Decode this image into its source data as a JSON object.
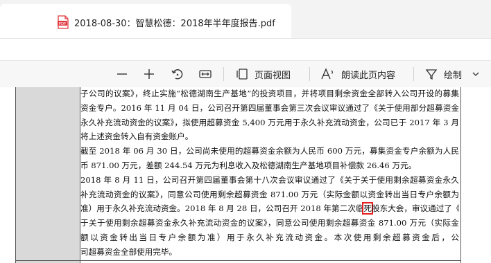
{
  "tab": {
    "title": "2018-08-30：智慧松德：2018年半年度报告.pdf",
    "icon": "pdf-file-icon",
    "icon_text": "PDF",
    "icon_color": "#e0383e"
  },
  "toolbar": {
    "zoom_out": "minus-icon",
    "zoom_in": "plus-icon",
    "rotate": "rotate-icon",
    "fit": "fit-width-icon",
    "page_view_label": "页面视图",
    "read_aloud_label": "朗读此页内容",
    "draw_label": "绘制"
  },
  "document": {
    "lines": [
      "子公司的议案》，终止实施“松德湖南生产基地”的投资项目，并将项目剩余资金全部转入公司开设的募集",
      "资金专户。2016 年 11 月 04 日，公司召开第四届董事会第三次会议审议通过了《关于使用部分超募资金",
      "永久补充流动资金的议案》，拟使用超募资金 5,400 万元用于永久补充流动资金，公司已于 2017 年 3 月",
      "将上述资金转入自有资金账户。",
      "截至 2018 年 06 月 30 日，公司尚未使用的超募资金余额为人民币 600 万元，募集资金专户余额为人民",
      "币 871.00 万元，差额 244.54 万元为利息收入及松德湖南生产基地项目补偿款 26.46 万元。",
      "2018 年 8 月 11 日，公司召开第四届董事会第十八次会议审议通过了《关于关于使用剩余超募资金永久",
      "补充流动资金的议案》，同意公司使用剩余超募资金 871.00 万元（实际金额以资金转出当日专户余额为",
      "准）用于永久补充流动资金。2018 年 8 月 28 日，公司召开 2018 年第二次临",
      "股东大会，审议通过了《关",
      "于关于使用剩余超募资金永久补充流动资金的议案》，同意公司使用剩余超募资金 871.00 万元（实际金",
      "额以资金转出当日专户余额为准）用于永久补充流动资金。本次使用剩余超募资金后，公",
      "司超募资金全部使用完毕。"
    ],
    "highlighted_char": "死",
    "highlight_color": "#e41e1e"
  }
}
